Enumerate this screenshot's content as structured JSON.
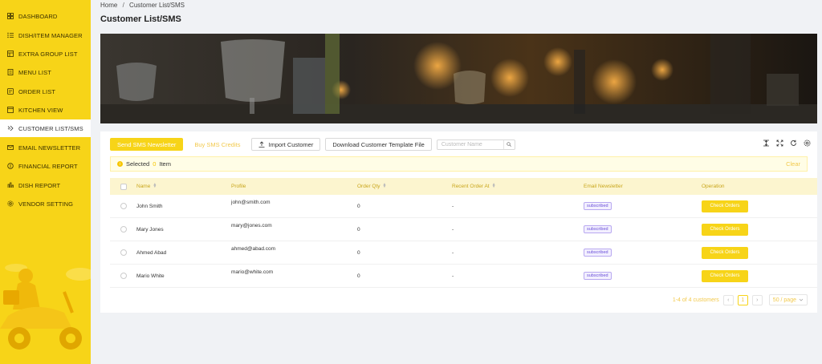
{
  "sidebar": {
    "items": [
      {
        "label": "DASHBOARD",
        "icon": "dashboard-icon"
      },
      {
        "label": "DISH/ITEM MANAGER",
        "icon": "list-icon"
      },
      {
        "label": "EXTRA GROUP LIST",
        "icon": "table-icon"
      },
      {
        "label": "MENU LIST",
        "icon": "menu-icon"
      },
      {
        "label": "ORDER LIST",
        "icon": "order-icon"
      },
      {
        "label": "KITCHEN VIEW",
        "icon": "kitchen-icon"
      },
      {
        "label": "CUSTOMER LIST/SMS",
        "icon": "customer-icon",
        "active": true
      },
      {
        "label": "EMAIL NEWSLETTER",
        "icon": "mail-icon"
      },
      {
        "label": "FINANCIAL REPORT",
        "icon": "finance-icon"
      },
      {
        "label": "DISH REPORT",
        "icon": "report-icon"
      },
      {
        "label": "VENDOR SETTING",
        "icon": "gear-icon"
      }
    ]
  },
  "breadcrumb": {
    "home": "Home",
    "separator": "/",
    "current": "Customer List/SMS"
  },
  "page_title": "Customer List/SMS",
  "toolbar": {
    "send_sms": "Send SMS Newsletter",
    "buy_credits": "Buy SMS Credits",
    "import": "Import Customer",
    "download_template": "Download Customer Template File",
    "search_placeholder": "Customer Name"
  },
  "alert": {
    "selected_label": "Selected",
    "count": "0",
    "item_label": "Item",
    "clear": "Clear"
  },
  "table": {
    "headers": {
      "name": "Name",
      "profile": "Profile",
      "order_qty": "Order Qty",
      "recent_order": "Recent Order At",
      "email_newsletter": "Email Newsletter",
      "operation": "Operation"
    },
    "rows": [
      {
        "name": "John Smith",
        "profile": "john@smith.com",
        "order_qty": "0",
        "recent_order": "-",
        "email_newsletter": "subscribed",
        "operation": "Check Orders"
      },
      {
        "name": "Mary Jones",
        "profile": "mary@jones.com",
        "order_qty": "0",
        "recent_order": "-",
        "email_newsletter": "subscribed",
        "operation": "Check Orders"
      },
      {
        "name": "Ahmed Abad",
        "profile": "ahmed@abad.com",
        "order_qty": "0",
        "recent_order": "-",
        "email_newsletter": "subscribed",
        "operation": "Check Orders"
      },
      {
        "name": "Mario White",
        "profile": "mario@white.com",
        "order_qty": "0",
        "recent_order": "-",
        "email_newsletter": "subscribed",
        "operation": "Check Orders"
      }
    ]
  },
  "pagination": {
    "summary": "1-4 of 4 customers",
    "prev": "‹",
    "current_page": "1",
    "next": "›",
    "page_size": "50 / page"
  },
  "colors": {
    "brand_yellow": "#f7d418",
    "badge_purple": "#6a4fd8"
  }
}
